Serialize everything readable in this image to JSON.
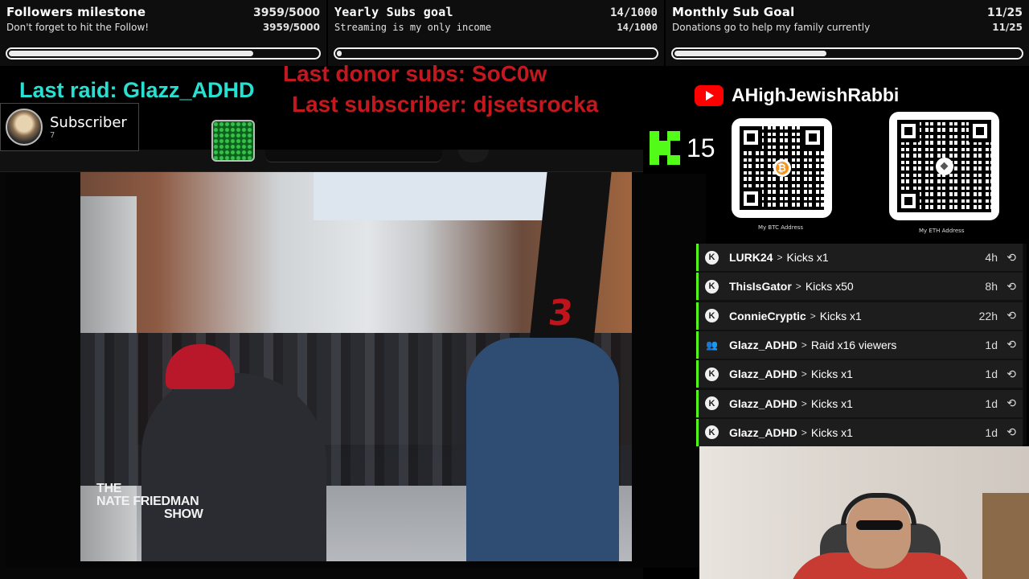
{
  "goals": [
    {
      "title": "Followers milestone",
      "count": "3959/5000",
      "subtitle": "Don't forget to hit the Follow!",
      "progress": 0.7918
    },
    {
      "title": "Yearly Subs goal",
      "count": "14/1000",
      "subtitle": "Streaming is my only income",
      "progress": 0.014
    },
    {
      "title": "Monthly Sub Goal",
      "count": "11/25",
      "subtitle": "Donations go to help my family currently",
      "progress": 0.44
    }
  ],
  "alerts": {
    "last_raid": "Last raid: Glazz_ADHD",
    "last_donor_subs": "Last donor subs: SoC0w",
    "last_subscriber": "Last subscriber: djsetsrocka"
  },
  "subscriber_card": {
    "label": "Subscriber",
    "count": "7"
  },
  "channel": {
    "name": "AHighJewishRabbi",
    "icon": "youtube-icon"
  },
  "kick_viewers": {
    "count": "15",
    "icon": "kick-logo-icon"
  },
  "crypto": [
    {
      "label": "My BTC Address",
      "coin_symbol": "₿",
      "icon": "bitcoin-icon"
    },
    {
      "label": "My ETH Address",
      "coin_symbol": "◆",
      "icon": "ethereum-icon"
    }
  ],
  "video": {
    "watermark_line1": "THE",
    "watermark_line2": "NATE FRIEDMAN",
    "watermark_line3": "SHOW"
  },
  "events": [
    {
      "icon": "kick-icon",
      "icon_glyph": "K",
      "user": "LURK24",
      "action": "Kicks x1",
      "time": "4h"
    },
    {
      "icon": "kick-icon",
      "icon_glyph": "K",
      "user": "ThisIsGator",
      "action": "Kicks x50",
      "time": "8h"
    },
    {
      "icon": "kick-icon",
      "icon_glyph": "K",
      "user": "ConnieCryptic",
      "action": "Kicks x1",
      "time": "22h"
    },
    {
      "icon": "raid-group-icon",
      "icon_glyph": "👥",
      "user": "Glazz_ADHD",
      "action": "Raid x16 viewers",
      "time": "1d"
    },
    {
      "icon": "kick-icon",
      "icon_glyph": "K",
      "user": "Glazz_ADHD",
      "action": "Kicks x1",
      "time": "1d"
    },
    {
      "icon": "kick-icon",
      "icon_glyph": "K",
      "user": "Glazz_ADHD",
      "action": "Kicks x1",
      "time": "1d"
    },
    {
      "icon": "kick-icon",
      "icon_glyph": "K",
      "user": "Glazz_ADHD",
      "action": "Kicks x1",
      "time": "1d"
    }
  ],
  "colors": {
    "kick_green": "#53fc18",
    "raid_cyan": "#27e0d2",
    "alert_red": "#c4181f",
    "youtube_red": "#ff0000",
    "btc_orange": "#f7931a"
  }
}
